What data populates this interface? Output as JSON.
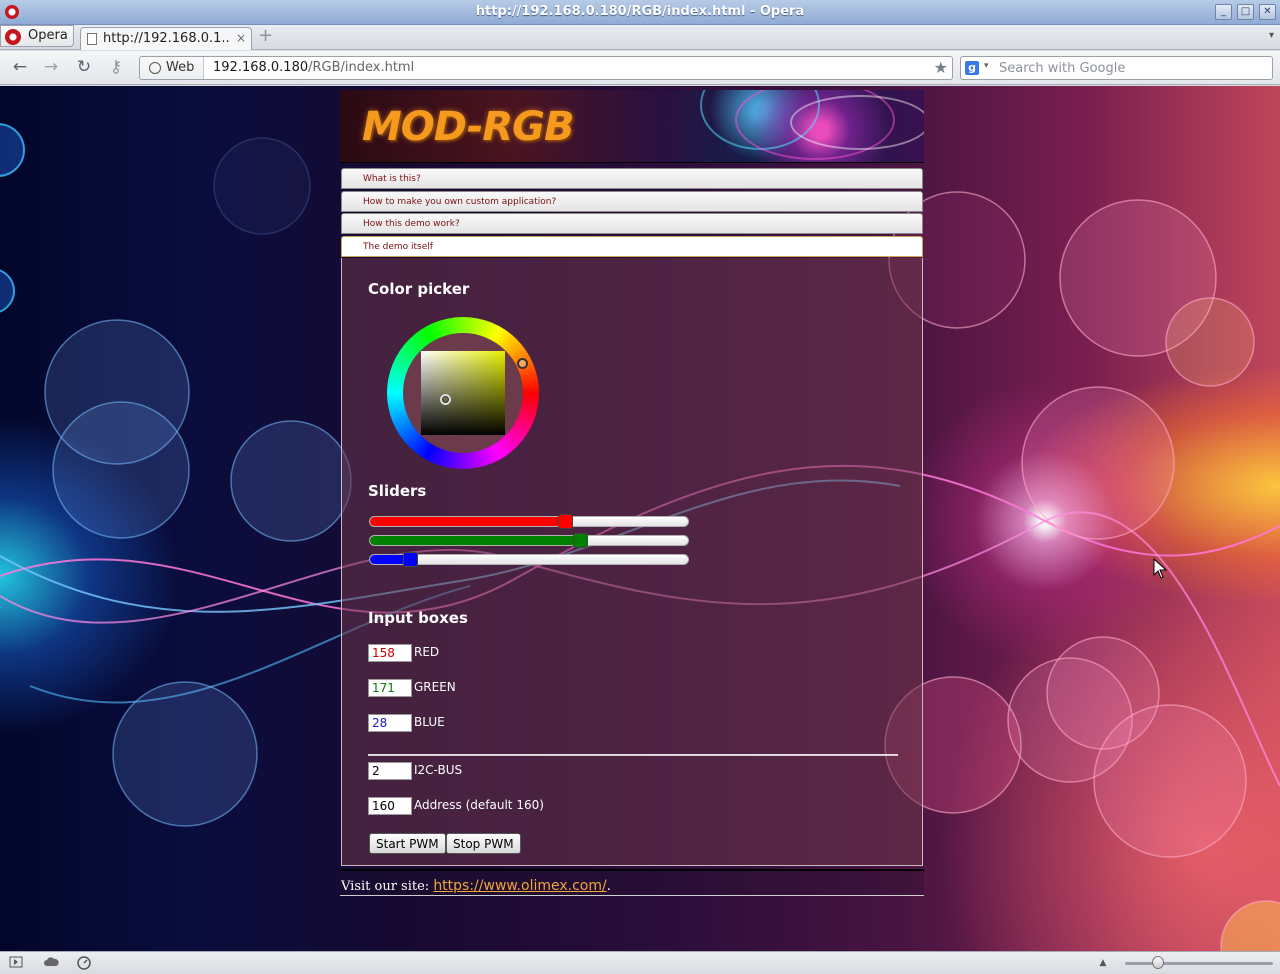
{
  "window": {
    "title": "http://192.168.0.180/RGB/index.html - Opera",
    "buttons": {
      "minimize": "_",
      "maximize": "□",
      "close": "✕"
    }
  },
  "tabbar": {
    "menu_label": "Opera",
    "tab_title": "http://192.168.0.1...",
    "tab_close": "×",
    "new_tab": "+",
    "tab_menu": "▾"
  },
  "toolbar": {
    "back": "←",
    "forward": "→",
    "reload": "↻",
    "key": "⚷",
    "web_badge": "Web",
    "url_host": "192.168.0.180",
    "url_path": "/RGB/index.html",
    "bookmark": "★",
    "search_engine": "g",
    "search_dropdown": "▾",
    "search_placeholder": "Search with Google"
  },
  "page": {
    "logo_text": "MOD-RGB",
    "accordion": [
      {
        "label": "What is this?"
      },
      {
        "label": "How to make you own custom application?"
      },
      {
        "label": "How this demo work?"
      },
      {
        "label": "The demo itself"
      }
    ],
    "sections": {
      "color_picker": "Color picker",
      "sliders": "Sliders",
      "input_boxes": "Input boxes"
    },
    "sliders": [
      {
        "name": "red",
        "value": 158,
        "max": 255,
        "color": "#ff0000"
      },
      {
        "name": "green",
        "value": 171,
        "max": 255,
        "color": "#008000"
      },
      {
        "name": "blue",
        "value": 28,
        "max": 255,
        "color": "#0000ff"
      }
    ],
    "inputs": {
      "red": {
        "value": "158",
        "label": "RED",
        "color": "#cc0000"
      },
      "green": {
        "value": "171",
        "label": "GREEN",
        "color": "#0a7a0a"
      },
      "blue": {
        "value": "28",
        "label": "BLUE",
        "color": "#1a1ad0"
      },
      "i2c_bus": {
        "value": "2",
        "label": "I2C-BUS"
      },
      "address": {
        "value": "160",
        "label": "Address (default 160)"
      }
    },
    "buttons": {
      "start": "Start PWM",
      "stop": "Stop PWM"
    },
    "footer": {
      "text_prefix": "Visit our site: ",
      "link": "https://www.olimex.com/",
      "text_suffix": "."
    }
  },
  "statusbar": {
    "icons": [
      "panel-toggle-icon",
      "cloud-icon",
      "speed-dial-icon"
    ],
    "zoom_level": 0.2
  }
}
